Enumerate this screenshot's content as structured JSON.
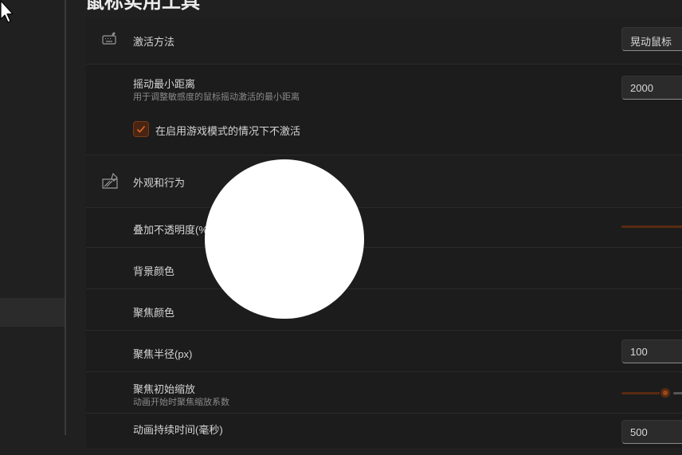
{
  "page": {
    "title": "鼠标实用工具"
  },
  "activation": {
    "method_label": "激活方法",
    "method_value": "晃动鼠标",
    "min_distance_label": "摇动最小距离",
    "min_distance_desc": "用于调整敏感度的鼠标摇动激活的最小距离",
    "min_distance_value": "2000",
    "game_mode_label": "在启用游戏模式的情况下不激活",
    "game_mode_checked": true
  },
  "appearance": {
    "section_label": "外观和行为",
    "opacity_label": "叠加不透明度(%)",
    "opacity_level": 1.0,
    "background_label": "背景颜色",
    "focus_color_label": "聚焦颜色",
    "radius_label": "聚焦半径(px)",
    "radius_value": "100",
    "initial_zoom_label": "聚焦初始缩放",
    "initial_zoom_desc": "动画开始时聚焦缩放系数",
    "initial_zoom_level": 0.6,
    "duration_label": "动画持续时间(毫秒)",
    "duration_value": "500"
  },
  "colors": {
    "accent": "#9b4a20",
    "accent_dark": "#5a2a12",
    "spotlight": "#ffffff"
  }
}
